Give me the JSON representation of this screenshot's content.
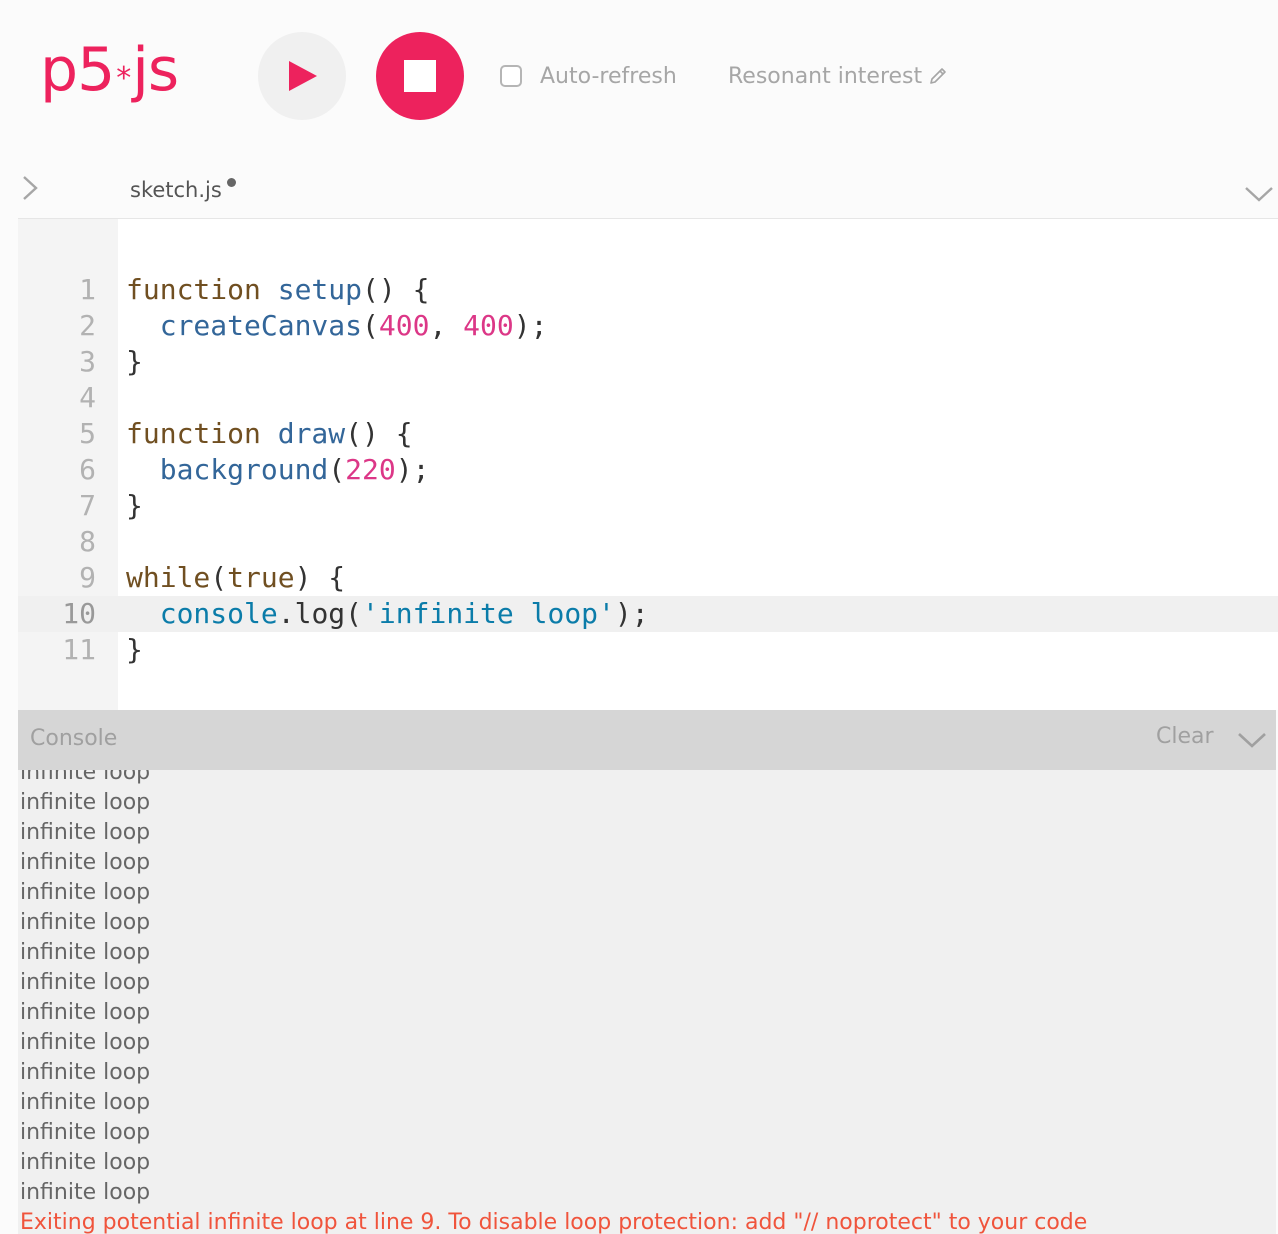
{
  "toolbar": {
    "logo_text_pre": "p5",
    "logo_star": "*",
    "logo_text_post": "js",
    "play_icon": "play-icon",
    "stop_icon": "stop-icon",
    "autorefresh_label": "Auto-refresh",
    "autorefresh_checked": false,
    "project_name": "Resonant interest",
    "edit_icon": "pencil-icon"
  },
  "file_tab": {
    "name": "sketch.js",
    "unsaved": true
  },
  "editor": {
    "active_line": 10,
    "lines": [
      {
        "number": "1"
      },
      {
        "number": "2"
      },
      {
        "number": "3"
      },
      {
        "number": "4"
      },
      {
        "number": "5"
      },
      {
        "number": "6"
      },
      {
        "number": "7"
      },
      {
        "number": "8"
      },
      {
        "number": "9"
      },
      {
        "number": "10"
      },
      {
        "number": "11"
      }
    ],
    "code": {
      "function_kw": "function",
      "setup": "setup",
      "paren_open_brace": "() {",
      "create_canvas": "createCanvas",
      "paren_open": "(",
      "arg_400_a": "400",
      "comma": ", ",
      "arg_400_b": "400",
      "paren_close_semi": ");",
      "brace_close": "}",
      "draw": "draw",
      "background": "background",
      "arg_220": "220",
      "while_kw": "while",
      "true_kw": "true",
      "paren_close_brace": ") {",
      "console_obj": "console",
      "dot_log": ".log(",
      "string_literal": "'infinite loop'"
    }
  },
  "console": {
    "title": "Console",
    "clear_label": "Clear",
    "collapse_icon": "chevron-down-icon",
    "messages": [
      "infinite loop",
      "infinite loop",
      "infinite loop",
      "infinite loop",
      "infinite loop",
      "infinite loop",
      "infinite loop",
      "infinite loop",
      "infinite loop",
      "infinite loop",
      "infinite loop",
      "infinite loop",
      "infinite loop",
      "infinite loop",
      "infinite loop"
    ],
    "error_message": "Exiting potential infinite loop at line 9. To disable loop protection: add \"// noprotect\" to your code"
  },
  "colors": {
    "brand": "#ed225d",
    "keyword": "#704f21",
    "function": "#336699",
    "number": "#dc3787",
    "string": "#0b7ca9",
    "error": "#f0543c"
  }
}
